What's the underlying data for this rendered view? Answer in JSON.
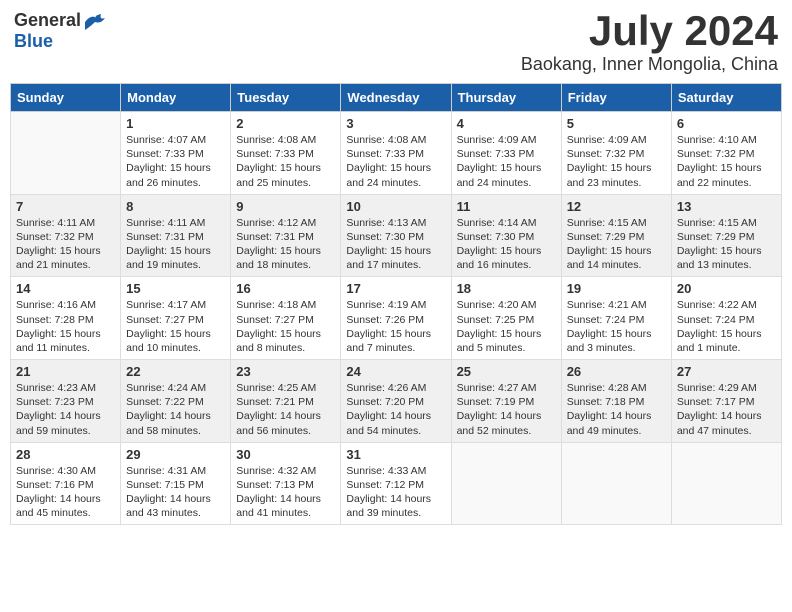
{
  "logo": {
    "general": "General",
    "blue": "Blue"
  },
  "title": "July 2024",
  "subtitle": "Baokang, Inner Mongolia, China",
  "days_of_week": [
    "Sunday",
    "Monday",
    "Tuesday",
    "Wednesday",
    "Thursday",
    "Friday",
    "Saturday"
  ],
  "weeks": [
    [
      {
        "day": "",
        "info": ""
      },
      {
        "day": "1",
        "info": "Sunrise: 4:07 AM\nSunset: 7:33 PM\nDaylight: 15 hours\nand 26 minutes."
      },
      {
        "day": "2",
        "info": "Sunrise: 4:08 AM\nSunset: 7:33 PM\nDaylight: 15 hours\nand 25 minutes."
      },
      {
        "day": "3",
        "info": "Sunrise: 4:08 AM\nSunset: 7:33 PM\nDaylight: 15 hours\nand 24 minutes."
      },
      {
        "day": "4",
        "info": "Sunrise: 4:09 AM\nSunset: 7:33 PM\nDaylight: 15 hours\nand 24 minutes."
      },
      {
        "day": "5",
        "info": "Sunrise: 4:09 AM\nSunset: 7:32 PM\nDaylight: 15 hours\nand 23 minutes."
      },
      {
        "day": "6",
        "info": "Sunrise: 4:10 AM\nSunset: 7:32 PM\nDaylight: 15 hours\nand 22 minutes."
      }
    ],
    [
      {
        "day": "7",
        "info": "Sunrise: 4:11 AM\nSunset: 7:32 PM\nDaylight: 15 hours\nand 21 minutes."
      },
      {
        "day": "8",
        "info": "Sunrise: 4:11 AM\nSunset: 7:31 PM\nDaylight: 15 hours\nand 19 minutes."
      },
      {
        "day": "9",
        "info": "Sunrise: 4:12 AM\nSunset: 7:31 PM\nDaylight: 15 hours\nand 18 minutes."
      },
      {
        "day": "10",
        "info": "Sunrise: 4:13 AM\nSunset: 7:30 PM\nDaylight: 15 hours\nand 17 minutes."
      },
      {
        "day": "11",
        "info": "Sunrise: 4:14 AM\nSunset: 7:30 PM\nDaylight: 15 hours\nand 16 minutes."
      },
      {
        "day": "12",
        "info": "Sunrise: 4:15 AM\nSunset: 7:29 PM\nDaylight: 15 hours\nand 14 minutes."
      },
      {
        "day": "13",
        "info": "Sunrise: 4:15 AM\nSunset: 7:29 PM\nDaylight: 15 hours\nand 13 minutes."
      }
    ],
    [
      {
        "day": "14",
        "info": "Sunrise: 4:16 AM\nSunset: 7:28 PM\nDaylight: 15 hours\nand 11 minutes."
      },
      {
        "day": "15",
        "info": "Sunrise: 4:17 AM\nSunset: 7:27 PM\nDaylight: 15 hours\nand 10 minutes."
      },
      {
        "day": "16",
        "info": "Sunrise: 4:18 AM\nSunset: 7:27 PM\nDaylight: 15 hours\nand 8 minutes."
      },
      {
        "day": "17",
        "info": "Sunrise: 4:19 AM\nSunset: 7:26 PM\nDaylight: 15 hours\nand 7 minutes."
      },
      {
        "day": "18",
        "info": "Sunrise: 4:20 AM\nSunset: 7:25 PM\nDaylight: 15 hours\nand 5 minutes."
      },
      {
        "day": "19",
        "info": "Sunrise: 4:21 AM\nSunset: 7:24 PM\nDaylight: 15 hours\nand 3 minutes."
      },
      {
        "day": "20",
        "info": "Sunrise: 4:22 AM\nSunset: 7:24 PM\nDaylight: 15 hours\nand 1 minute."
      }
    ],
    [
      {
        "day": "21",
        "info": "Sunrise: 4:23 AM\nSunset: 7:23 PM\nDaylight: 14 hours\nand 59 minutes."
      },
      {
        "day": "22",
        "info": "Sunrise: 4:24 AM\nSunset: 7:22 PM\nDaylight: 14 hours\nand 58 minutes."
      },
      {
        "day": "23",
        "info": "Sunrise: 4:25 AM\nSunset: 7:21 PM\nDaylight: 14 hours\nand 56 minutes."
      },
      {
        "day": "24",
        "info": "Sunrise: 4:26 AM\nSunset: 7:20 PM\nDaylight: 14 hours\nand 54 minutes."
      },
      {
        "day": "25",
        "info": "Sunrise: 4:27 AM\nSunset: 7:19 PM\nDaylight: 14 hours\nand 52 minutes."
      },
      {
        "day": "26",
        "info": "Sunrise: 4:28 AM\nSunset: 7:18 PM\nDaylight: 14 hours\nand 49 minutes."
      },
      {
        "day": "27",
        "info": "Sunrise: 4:29 AM\nSunset: 7:17 PM\nDaylight: 14 hours\nand 47 minutes."
      }
    ],
    [
      {
        "day": "28",
        "info": "Sunrise: 4:30 AM\nSunset: 7:16 PM\nDaylight: 14 hours\nand 45 minutes."
      },
      {
        "day": "29",
        "info": "Sunrise: 4:31 AM\nSunset: 7:15 PM\nDaylight: 14 hours\nand 43 minutes."
      },
      {
        "day": "30",
        "info": "Sunrise: 4:32 AM\nSunset: 7:13 PM\nDaylight: 14 hours\nand 41 minutes."
      },
      {
        "day": "31",
        "info": "Sunrise: 4:33 AM\nSunset: 7:12 PM\nDaylight: 14 hours\nand 39 minutes."
      },
      {
        "day": "",
        "info": ""
      },
      {
        "day": "",
        "info": ""
      },
      {
        "day": "",
        "info": ""
      }
    ]
  ]
}
